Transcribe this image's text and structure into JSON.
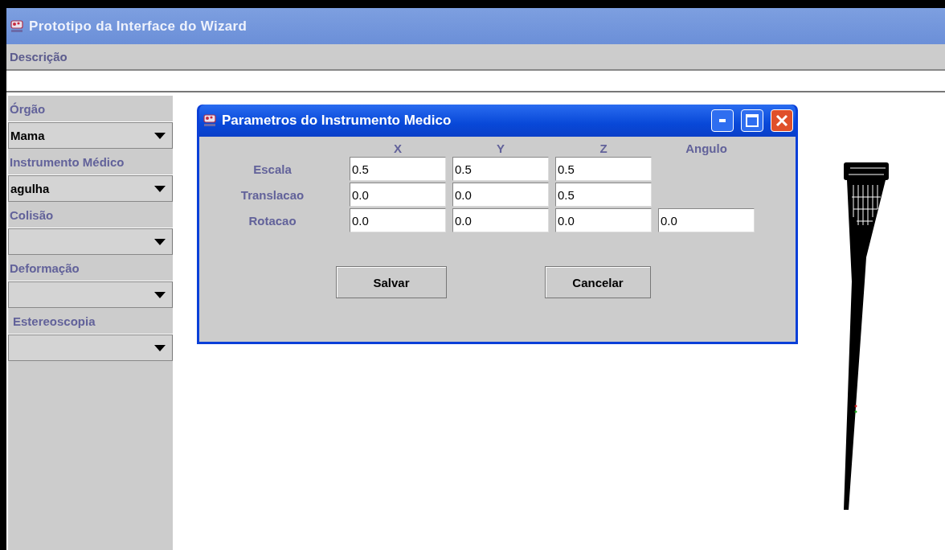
{
  "window": {
    "title": "Prototipo da Interface do Wizard"
  },
  "menu": {
    "label": "Descrição"
  },
  "sidebar": [
    {
      "label": "Órgão",
      "value": "Mama"
    },
    {
      "label": "Instrumento Médico",
      "value": "agulha"
    },
    {
      "label": "Colisão"
    },
    {
      "label": "Deformação"
    },
    {
      "label": "Estereoscopia"
    }
  ],
  "dialog": {
    "title": "Parametros do Instrumento Medico",
    "columns": [
      "X",
      "Y",
      "Z",
      "Angulo"
    ],
    "rows": [
      {
        "label": "Escala",
        "values": [
          "0.5",
          "0.5",
          "0.5"
        ]
      },
      {
        "label": "Translacao",
        "values": [
          "0.0",
          "0.0",
          "0.5"
        ]
      },
      {
        "label": "Rotacao",
        "values": [
          "0.0",
          "0.0",
          "0.0",
          "0.0"
        ]
      }
    ],
    "buttons": [
      "Salvar",
      "Cancelar"
    ]
  }
}
